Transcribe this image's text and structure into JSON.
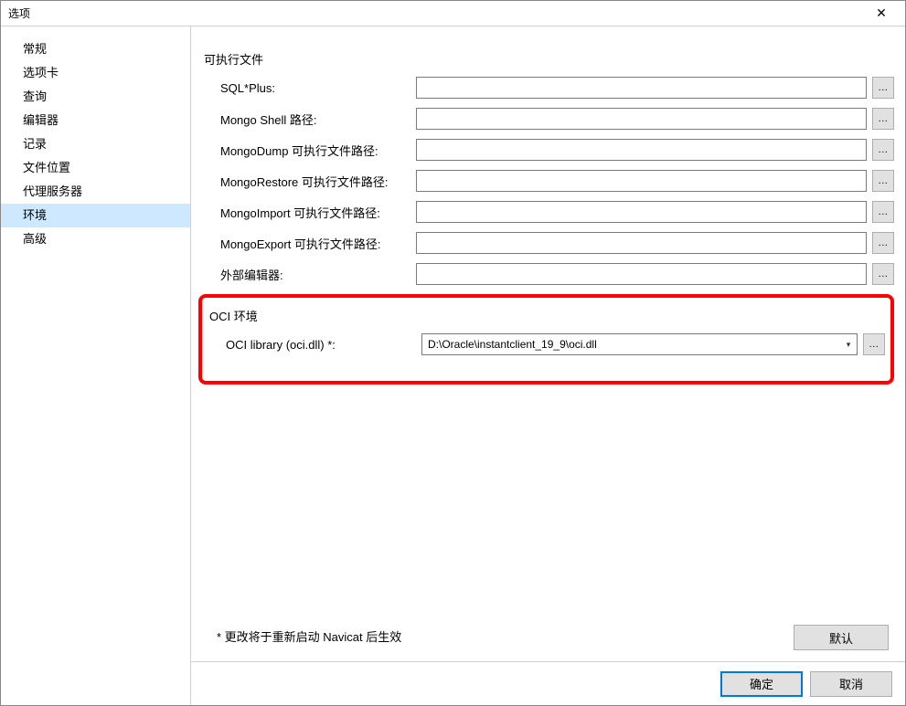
{
  "window": {
    "title": "选项"
  },
  "sidebar": {
    "items": [
      {
        "label": "常规"
      },
      {
        "label": "选项卡"
      },
      {
        "label": "查询"
      },
      {
        "label": "编辑器"
      },
      {
        "label": "记录"
      },
      {
        "label": "文件位置"
      },
      {
        "label": "代理服务器"
      },
      {
        "label": "环境",
        "selected": true
      },
      {
        "label": "高级"
      }
    ]
  },
  "executables": {
    "title": "可执行文件",
    "fields": [
      {
        "label": "SQL*Plus:",
        "value": ""
      },
      {
        "label": "Mongo Shell 路径:",
        "value": ""
      },
      {
        "label": "MongoDump 可执行文件路径:",
        "value": ""
      },
      {
        "label": "MongoRestore 可执行文件路径:",
        "value": ""
      },
      {
        "label": "MongoImport 可执行文件路径:",
        "value": ""
      },
      {
        "label": "MongoExport 可执行文件路径:",
        "value": ""
      },
      {
        "label": "外部编辑器:",
        "value": ""
      }
    ]
  },
  "oci": {
    "title": "OCI 环境",
    "label": "OCI library (oci.dll) *:",
    "value": "D:\\Oracle\\instantclient_19_9\\oci.dll"
  },
  "footer_note": "* 更改将于重新启动 Navicat 后生效",
  "buttons": {
    "default": "默认",
    "ok": "确定",
    "cancel": "取消",
    "browse": "..."
  }
}
